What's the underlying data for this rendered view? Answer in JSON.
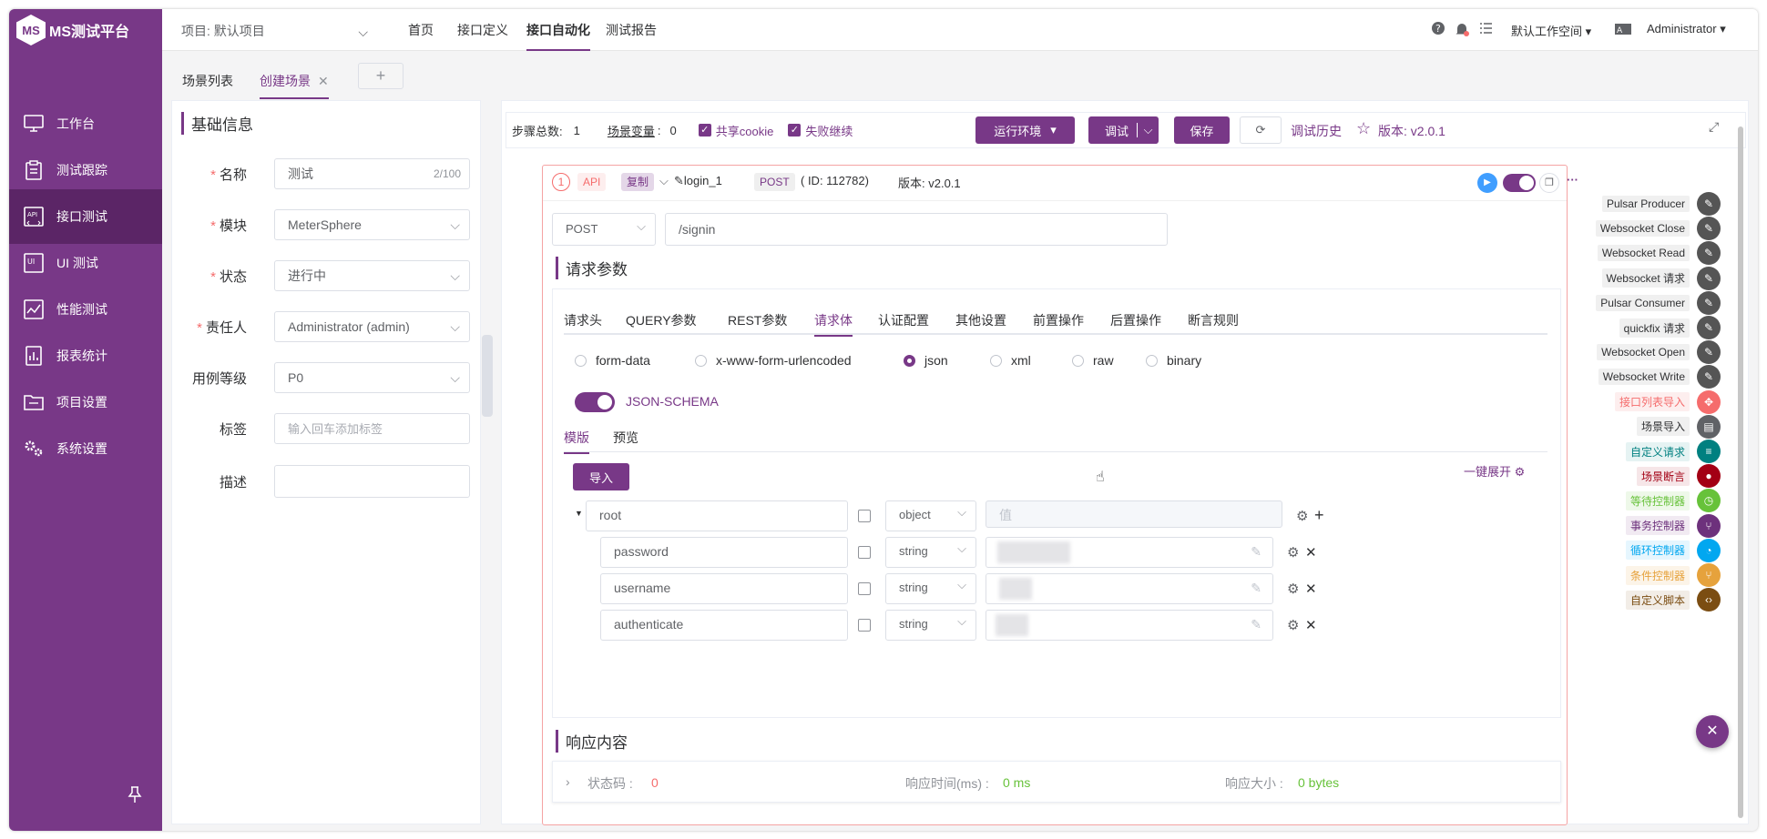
{
  "app": {
    "logo_text": "MS测试平台",
    "logo_mark": "MS"
  },
  "sidebar": {
    "items": [
      {
        "label": "工作台",
        "icon": "monitor-icon"
      },
      {
        "label": "测试跟踪",
        "icon": "clipboard-icon"
      },
      {
        "label": "接口测试",
        "icon": "api-icon"
      },
      {
        "label": "UI 测试",
        "icon": "ui-icon"
      },
      {
        "label": "性能测试",
        "icon": "chart-icon"
      },
      {
        "label": "报表统计",
        "icon": "report-icon"
      },
      {
        "label": "项目设置",
        "icon": "folder-icon"
      },
      {
        "label": "系统设置",
        "icon": "gears-icon"
      }
    ]
  },
  "topbar": {
    "project": "项目: 默认项目",
    "menus": [
      "首页",
      "接口定义",
      "接口自动化",
      "测试报告"
    ],
    "workspace": "默认工作空间",
    "user": "Administrator"
  },
  "tabs": {
    "list": "场景列表",
    "active": "创建场景",
    "add": "+"
  },
  "basic": {
    "title": "基础信息",
    "name_label": "名称",
    "name_value": "测试",
    "name_count": "2/100",
    "module_label": "模块",
    "module_value": "MeterSphere",
    "status_label": "状态",
    "status_value": "进行中",
    "owner_label": "责任人",
    "owner_value": "Administrator (admin)",
    "level_label": "用例等级",
    "level_value": "P0",
    "tag_label": "标签",
    "tag_placeholder": "输入回车添加标签",
    "desc_label": "描述"
  },
  "toolbar": {
    "steps_label": "步骤总数:",
    "steps_value": "1",
    "vars_label": "场景变量",
    "vars_value": "0",
    "cookie": "共享cookie",
    "continue": "失败继续",
    "env": "运行环境",
    "debug": "调试",
    "save": "保存",
    "history": "调试历史",
    "version": "版本: v2.0.1"
  },
  "step": {
    "index": "1",
    "type": "API",
    "copy": "复制",
    "name": "login_1",
    "method": "POST",
    "id": "( ID: 112782)",
    "version": "版本: v2.0.1",
    "req_method": "POST",
    "url": "/signin",
    "params_title": "请求参数",
    "req_tabs": [
      "请求头",
      "QUERY参数",
      "REST参数",
      "请求体",
      "认证配置",
      "其他设置",
      "前置操作",
      "后置操作",
      "断言规则"
    ],
    "body_types": [
      "form-data",
      "x-www-form-urlencoded",
      "json",
      "xml",
      "raw",
      "binary"
    ],
    "schema_label": "JSON-SCHEMA",
    "schema_tabs": [
      "模版",
      "预览"
    ],
    "import": "导入",
    "expand": "一键展开",
    "rows": [
      {
        "name": "root",
        "type": "object",
        "value": "值"
      },
      {
        "name": "password",
        "type": "string"
      },
      {
        "name": "username",
        "type": "string"
      },
      {
        "name": "authenticate",
        "type": "string"
      }
    ],
    "resp_title": "响应内容",
    "resp": {
      "code_label": "状态码 :",
      "code": "0",
      "time_label": "响应时间(ms) :",
      "time": "0 ms",
      "size_label": "响应大小 :",
      "size": "0 bytes"
    }
  },
  "palette": [
    {
      "label": "Pulsar Producer",
      "color": "#555555",
      "text": "#303133",
      "bg": "#f0f0f0"
    },
    {
      "label": "Websocket Close",
      "color": "#555555",
      "text": "#303133",
      "bg": "#f0f0f0"
    },
    {
      "label": "Websocket Read",
      "color": "#555555",
      "text": "#303133",
      "bg": "#f0f0f0"
    },
    {
      "label": "Websocket 请求",
      "color": "#555555",
      "text": "#303133",
      "bg": "#f0f0f0"
    },
    {
      "label": "Pulsar Consumer",
      "color": "#555555",
      "text": "#303133",
      "bg": "#f0f0f0"
    },
    {
      "label": "quickfix 请求",
      "color": "#555555",
      "text": "#303133",
      "bg": "#f0f0f0"
    },
    {
      "label": "Websocket Open",
      "color": "#555555",
      "text": "#303133",
      "bg": "#f0f0f0"
    },
    {
      "label": "Websocket Write",
      "color": "#555555",
      "text": "#303133",
      "bg": "#f0f0f0"
    },
    {
      "label": "接口列表导入",
      "color": "#f56c6c",
      "text": "#f56c6c",
      "bg": "#fdeeee"
    },
    {
      "label": "场景导入",
      "color": "#606266",
      "text": "#303133",
      "bg": "#f0f0f0"
    },
    {
      "label": "自定义请求",
      "color": "#008080",
      "text": "#008080",
      "bg": "#e6f3f3"
    },
    {
      "label": "场景断言",
      "color": "#a30014",
      "text": "#a30014",
      "bg": "#f6e6e8"
    },
    {
      "label": "等待控制器",
      "color": "#67c23a",
      "text": "#67c23a",
      "bg": "#eef8e9"
    },
    {
      "label": "事务控制器",
      "color": "#6d317c",
      "text": "#6d317c",
      "bg": "#f1eaf2"
    },
    {
      "label": "循环控制器",
      "color": "#02a7f0",
      "text": "#02a7f0",
      "bg": "#e6f6fe"
    },
    {
      "label": "条件控制器",
      "color": "#e6a23c",
      "text": "#e6a23c",
      "bg": "#fcf4e8"
    },
    {
      "label": "自定义脚本",
      "color": "#7b4d12",
      "text": "#7b4d12",
      "bg": "#f2ede7"
    }
  ]
}
